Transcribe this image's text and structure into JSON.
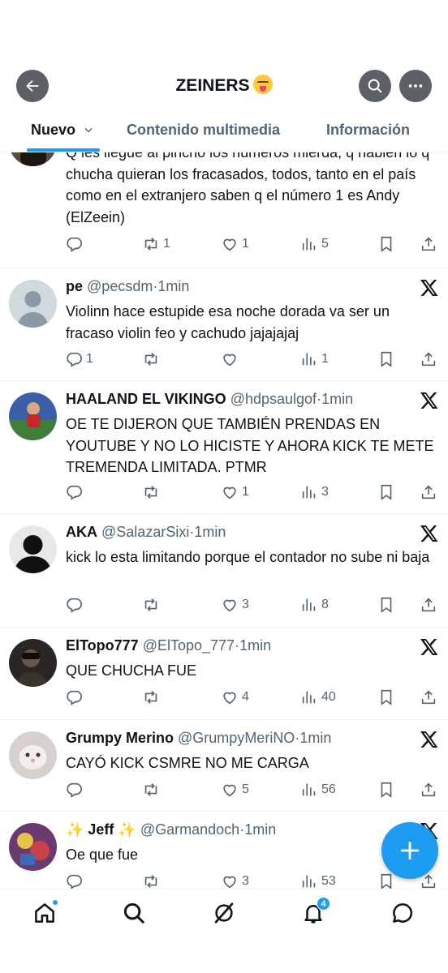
{
  "header": {
    "title": "ZEINERS",
    "title_emoji": "squinting-face-with-tongue"
  },
  "tabs": [
    {
      "label": "Nuevo",
      "active": true
    },
    {
      "label": "Contenido multimedia",
      "active": false
    },
    {
      "label": "Información",
      "active": false
    }
  ],
  "posts": [
    {
      "name": "",
      "handle": "",
      "time": "",
      "text": "Q les llegue al pincho los números mierda, q hablen lo q chucha quieran los fracasados, todos, tanto en el país como en el extranjero saben q el número 1 es Andy (ElZeein)",
      "stats": {
        "replies": "",
        "reposts": "1",
        "likes": "1",
        "views": "5"
      }
    },
    {
      "name": "pe",
      "handle": "@pecsdm",
      "time": "1min",
      "text": "Violinn hace estupide esa noche dorada va ser un fracaso violin  feo y cachudo jajajajaj",
      "stats": {
        "replies": "1",
        "reposts": "",
        "likes": "",
        "views": "1"
      }
    },
    {
      "name": "HAALAND EL VIKINGO",
      "handle": "@hdpsaulgof",
      "time": "1min",
      "text": "OE TE DIJERON QUE TAMBIÉN PRENDAS EN YOUTUBE Y NO LO HICISTE Y AHORA KICK TE METE TREMENDA LIMITADA. PTMR",
      "stats": {
        "replies": "",
        "reposts": "",
        "likes": "1",
        "views": "3"
      }
    },
    {
      "name": "AKA",
      "handle": "@SalazarSixi",
      "time": "1min",
      "text": "kick lo esta limitando porque el contador no sube ni baja",
      "stats": {
        "replies": "",
        "reposts": "",
        "likes": "3",
        "views": "8"
      }
    },
    {
      "name": "ElTopo777",
      "handle": "@ElTopo_777",
      "time": "1min",
      "text": "QUE CHUCHA FUE",
      "stats": {
        "replies": "",
        "reposts": "",
        "likes": "4",
        "views": "40"
      }
    },
    {
      "name": "Grumpy Merino",
      "handle": "@GrumpyMeriNO",
      "time": "1min",
      "text": "CAYÓ KICK CSMRE NO ME CARGA",
      "stats": {
        "replies": "",
        "reposts": "",
        "likes": "5",
        "views": "56"
      }
    },
    {
      "name": "✨ Jeff ✨",
      "handle": "@Garmandoch",
      "time": "1min",
      "text": "Oe que fue",
      "stats": {
        "replies": "",
        "reposts": "",
        "likes": "3",
        "views": "53"
      }
    }
  ],
  "bottom_nav": {
    "items": [
      "home-icon",
      "search-icon",
      "grok-icon",
      "bell-icon",
      "messages-icon"
    ],
    "notification_count": "4"
  },
  "colors": {
    "accent": "#1d9bf0",
    "text": "#0f1419",
    "muted": "#536471"
  }
}
